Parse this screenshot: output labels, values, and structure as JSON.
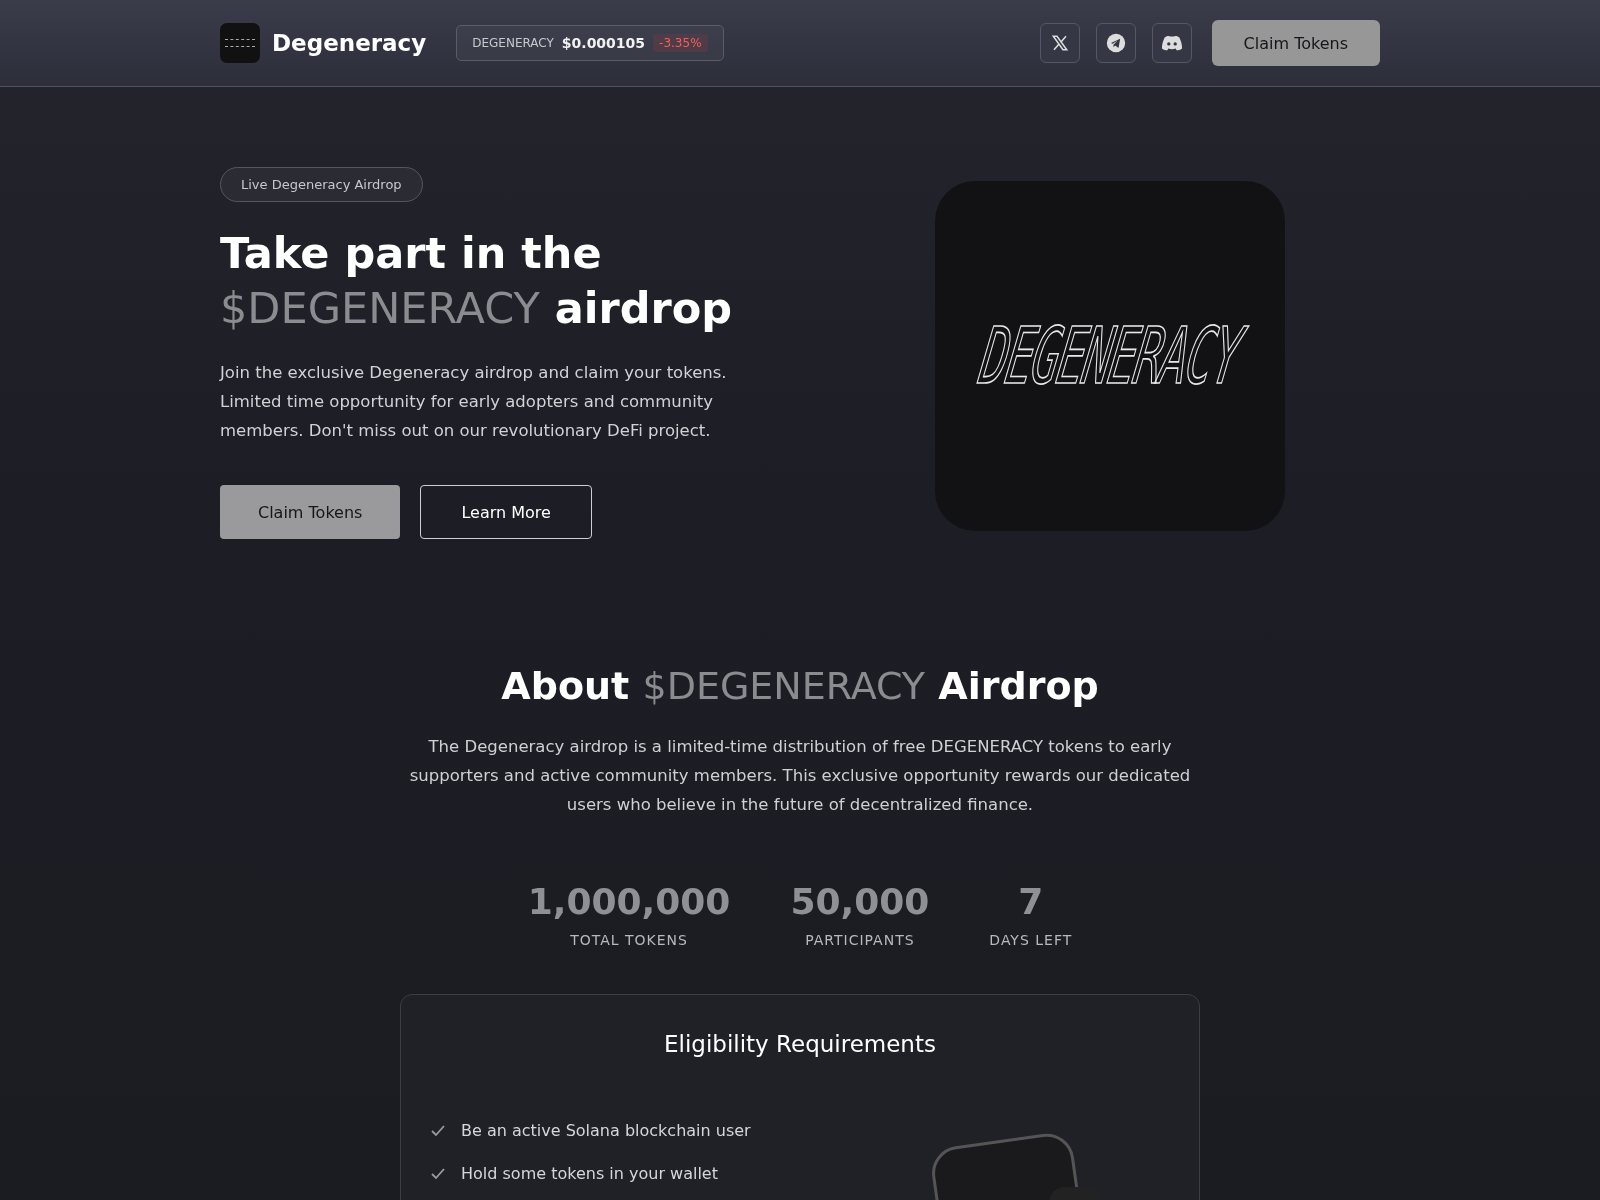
{
  "header": {
    "brand": "Degeneracy",
    "ticker": {
      "symbol": "DEGENERACY",
      "price": "$0.000105",
      "change": "-3.35%",
      "negative": true
    },
    "socials": [
      {
        "kind": "x"
      },
      {
        "kind": "telegram"
      },
      {
        "kind": "discord"
      }
    ],
    "cta": "Claim Tokens"
  },
  "hero": {
    "badge": "Live Degeneracy Airdrop",
    "title": {
      "line_1": "Take part in the",
      "highlight": "$DEGENERACY",
      "rest": "airdrop"
    },
    "description": "Join the exclusive Degeneracy airdrop and claim your tokens. Limited time opportunity for early adopters and community members. Don't miss out on our revolutionary DeFi project.",
    "buttons": [
      {
        "label": "Claim Tokens",
        "kind": "primary"
      },
      {
        "label": "Learn More",
        "kind": "outline"
      }
    ],
    "logo_text": "DEGENERACY"
  },
  "about": {
    "title": {
      "start": "About",
      "highlight": "$DEGENERACY",
      "rest": "Airdrop"
    },
    "description": "The Degeneracy airdrop is a limited-time distribution of free DEGENERACY tokens to early supporters and active community members. This exclusive opportunity rewards our dedicated users who believe in the future of decentralized finance.",
    "stats": [
      {
        "value": "1,000,000",
        "label": "TOTAL TOKENS"
      },
      {
        "value": "50,000",
        "label": "PARTICIPANTS"
      },
      {
        "value": "7",
        "label": "DAYS LEFT"
      }
    ]
  },
  "eligibility": {
    "title": "Eligibility Requirements",
    "items": [
      "Be an active Solana blockchain user",
      "Hold some tokens in your wallet"
    ]
  }
}
